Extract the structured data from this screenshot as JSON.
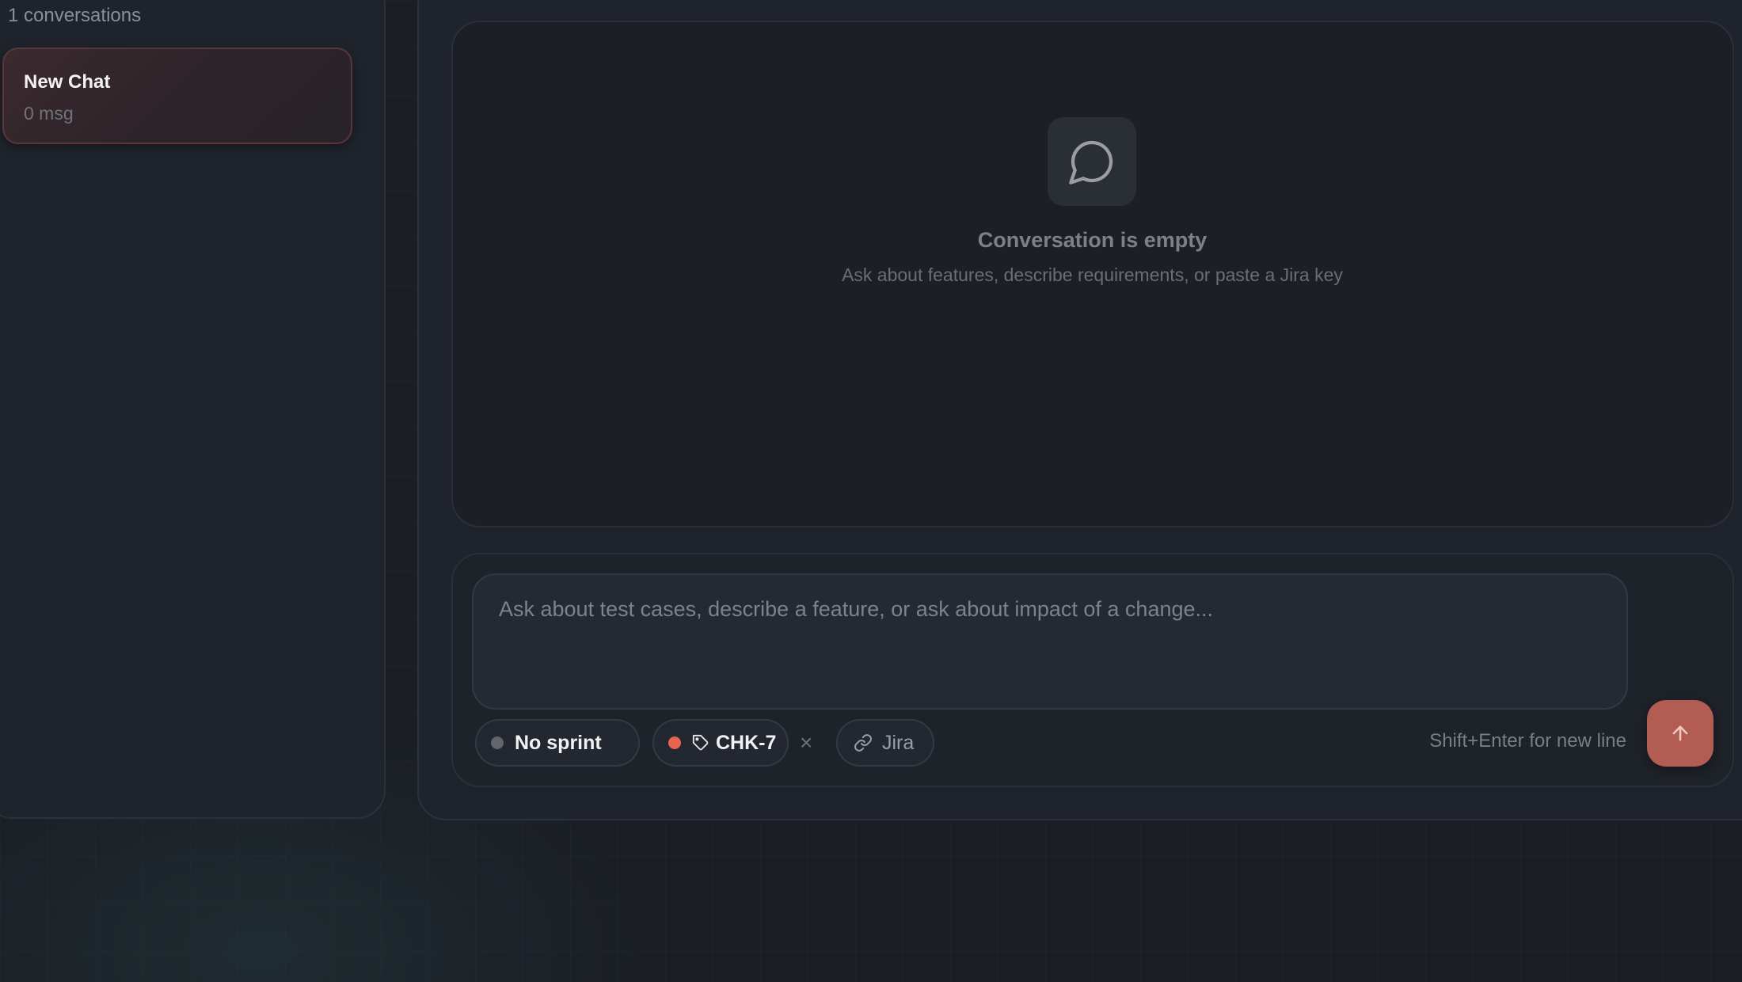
{
  "sidebar": {
    "conversation_count": "1 conversations",
    "items": [
      {
        "title": "New Chat",
        "meta": "0 msg"
      }
    ]
  },
  "conversation": {
    "empty_icon": "message-circle-icon",
    "empty_title": "Conversation is empty",
    "empty_subtitle": "Ask about features, describe requirements, or paste a Jira key"
  },
  "composer": {
    "placeholder": "Ask about test cases, describe a feature, or ask about impact of a change...",
    "value": "",
    "sprint_label": "No sprint",
    "tag_label": "CHK-7",
    "clear_symbol": "×",
    "jira_label": "Jira",
    "hint": "Shift+Enter for new line",
    "send_icon": "arrow-up-icon"
  },
  "colors": {
    "accent": "#b35c53",
    "tag_dot": "#e5654f",
    "sprint_dot": "#62656c",
    "background": "#1b1e25"
  }
}
